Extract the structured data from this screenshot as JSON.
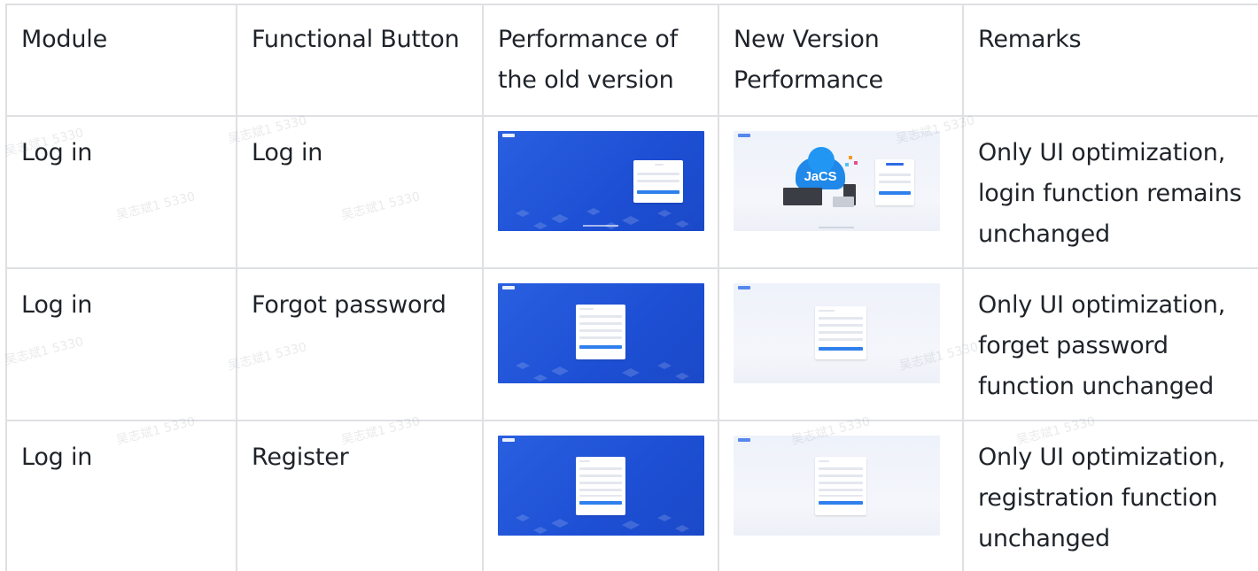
{
  "table": {
    "headers": [
      "Module",
      "Functional Button",
      "Performance of the old version",
      "New Version Performance",
      "Remarks"
    ],
    "rows": [
      {
        "module": "Log in",
        "button": "Log in",
        "old_image": "old-login-screenshot",
        "new_image": "new-login-screenshot",
        "remarks": "Only UI optimization, login function remains unchanged"
      },
      {
        "module": "Log in",
        "button": "Forgot password",
        "old_image": "old-forgot-password-screenshot",
        "new_image": "new-forgot-password-screenshot",
        "remarks": "Only UI optimization, forget password function unchanged"
      },
      {
        "module": "Log in",
        "button": "Register",
        "old_image": "old-register-screenshot",
        "new_image": "new-register-screenshot",
        "remarks": "Only UI optimization, registration function unchanged"
      }
    ]
  },
  "thumbnail": {
    "jacs_label": "JaCS"
  },
  "watermark": {
    "text": "吴志斌1 5330"
  },
  "colors": {
    "border": "#dee0e3",
    "text": "#1f2329",
    "old_bg": "#1d4fd4",
    "new_bg": "#f1f4fa",
    "accent": "#2f80ed"
  }
}
